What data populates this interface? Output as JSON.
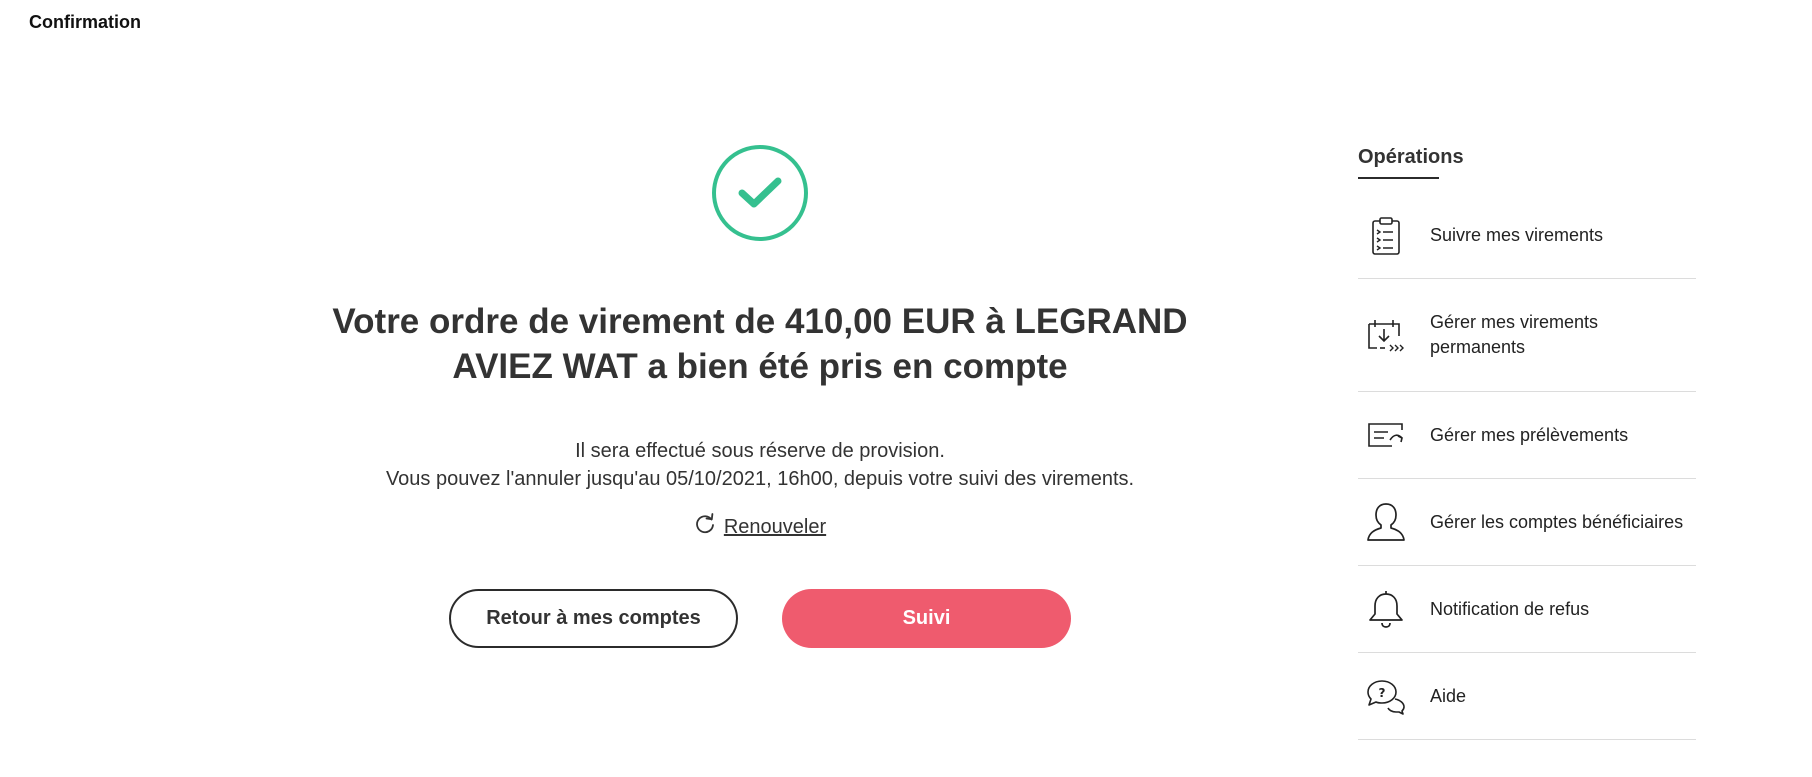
{
  "page": {
    "title": "Confirmation"
  },
  "main": {
    "headline": "Votre ordre de virement de 410,00 EUR à LEGRAND AVIEZ WAT a bien été pris en compte",
    "info_line1": "Il sera effectué sous réserve de provision.",
    "info_line2": "Vous pouvez l'annuler jusqu'au 05/10/2021, 16h00, depuis votre suivi des virements.",
    "renew_label": "Renouveler",
    "back_button": "Retour à mes comptes",
    "follow_button": "Suivi",
    "success_icon": "check-circle-icon"
  },
  "sidebar": {
    "title": "Opérations",
    "items": [
      {
        "label": "Suivre mes virements",
        "icon": "checklist-icon"
      },
      {
        "label": "Gérer mes virements permanents",
        "icon": "recurring-transfer-icon"
      },
      {
        "label": "Gérer mes prélèvements",
        "icon": "direct-debit-icon"
      },
      {
        "label": "Gérer les comptes bénéficiaires",
        "icon": "person-icon"
      },
      {
        "label": "Notification de refus",
        "icon": "bell-icon"
      },
      {
        "label": "Aide",
        "icon": "help-chat-icon"
      }
    ]
  },
  "colors": {
    "success": "#35c08f",
    "primary_button": "#ef5b6e",
    "text": "#333333",
    "divider": "#dcdcdc"
  }
}
